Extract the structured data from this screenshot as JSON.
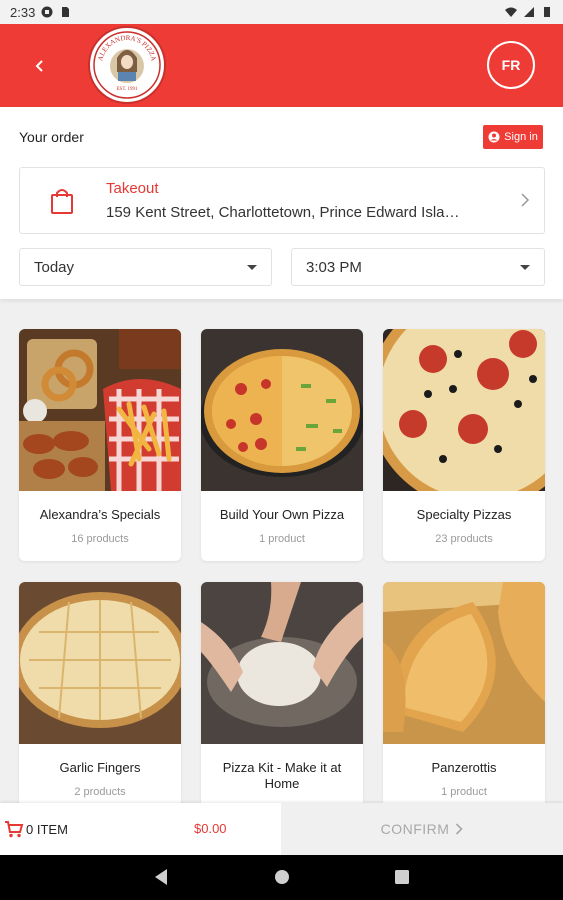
{
  "status_bar": {
    "time": "2:33"
  },
  "header": {
    "logo_text": "ALEXANDRA'S PIZZA",
    "logo_est": "EST. 1991",
    "language_button": "FR"
  },
  "order": {
    "title": "Your order",
    "sign_in_label": "Sign in",
    "mode": "Takeout",
    "address": "159 Kent Street, Charlottetown, Prince Edward Isla…",
    "day": "Today",
    "time": "3:03 PM"
  },
  "categories": [
    {
      "name": "Alexandra’s Specials",
      "count": "16 products"
    },
    {
      "name": "Build Your Own Pizza",
      "count": "1 product"
    },
    {
      "name": "Specialty Pizzas",
      "count": "23 products"
    },
    {
      "name": "Garlic Fingers",
      "count": "2 products"
    },
    {
      "name": "Pizza Kit - Make it at Home",
      "count": ""
    },
    {
      "name": "Panzerottis",
      "count": "1 product"
    }
  ],
  "footer": {
    "item_count": "0 ITEM",
    "total": "$0.00",
    "confirm_label": "CONFIRM"
  },
  "colors": {
    "brand_red": "#ef3b36",
    "price_red": "#e53935"
  }
}
